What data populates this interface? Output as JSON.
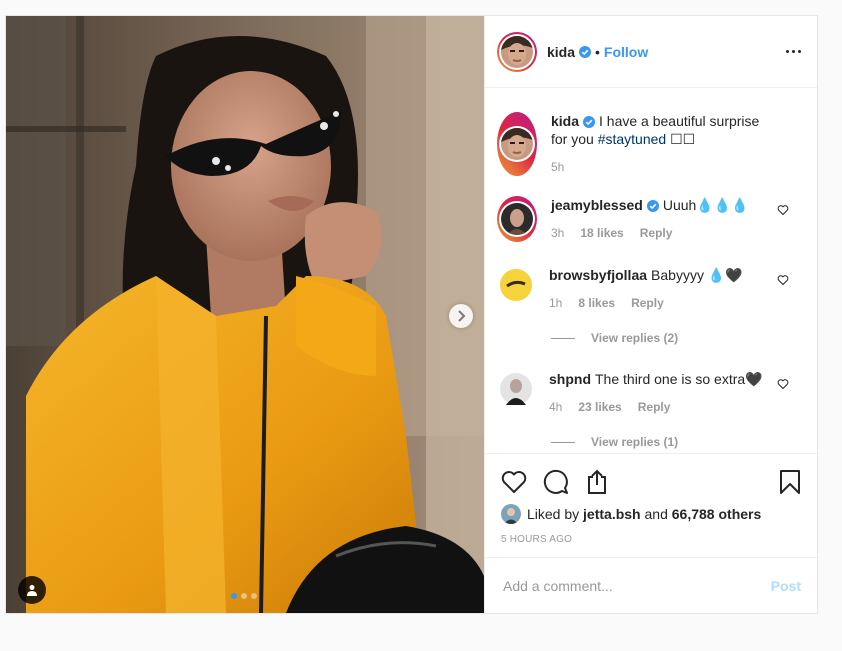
{
  "post": {
    "author": {
      "username": "kida",
      "verified": true,
      "follow_label": "Follow",
      "bullet": "•"
    },
    "caption": {
      "username": "kida",
      "text": "I have a beautiful surprise for you",
      "hashtag": "#staytuned",
      "emoji": "☐☐",
      "time": "5h"
    },
    "comments": [
      {
        "username": "jeamyblessed",
        "verified": true,
        "text": "Uuuh💧💧💧",
        "time": "3h",
        "likes": "18 likes",
        "reply": "Reply"
      },
      {
        "username": "browsbyfjollaa",
        "verified": false,
        "text": "Babyyyy 💧🖤",
        "time": "1h",
        "likes": "8 likes",
        "reply": "Reply",
        "view_replies": "View replies (2)"
      },
      {
        "username": "shpnd",
        "verified": false,
        "text": "The third one is so extra🖤",
        "time": "4h",
        "likes": "23 likes",
        "reply": "Reply",
        "view_replies": "View replies (1)"
      }
    ],
    "likes": {
      "prefix": "Liked by",
      "user": "jetta.bsh",
      "connector": "and",
      "others": "66,788 others"
    },
    "timestamp": "5 HOURS AGO",
    "add_comment_placeholder": "Add a comment...",
    "post_button": "Post",
    "carousel": {
      "count": 3,
      "active_index": 0
    }
  },
  "colors": {
    "accent": "#3897f0",
    "verified": "#3897f0",
    "jacket": "#f2a81d",
    "post_disabled": "#b3dbff"
  },
  "icons": [
    "more-options-icon",
    "verified-icon",
    "heart-icon",
    "comment-icon",
    "share-icon",
    "bookmark-icon",
    "chevron-right-icon",
    "user-tag-icon"
  ]
}
